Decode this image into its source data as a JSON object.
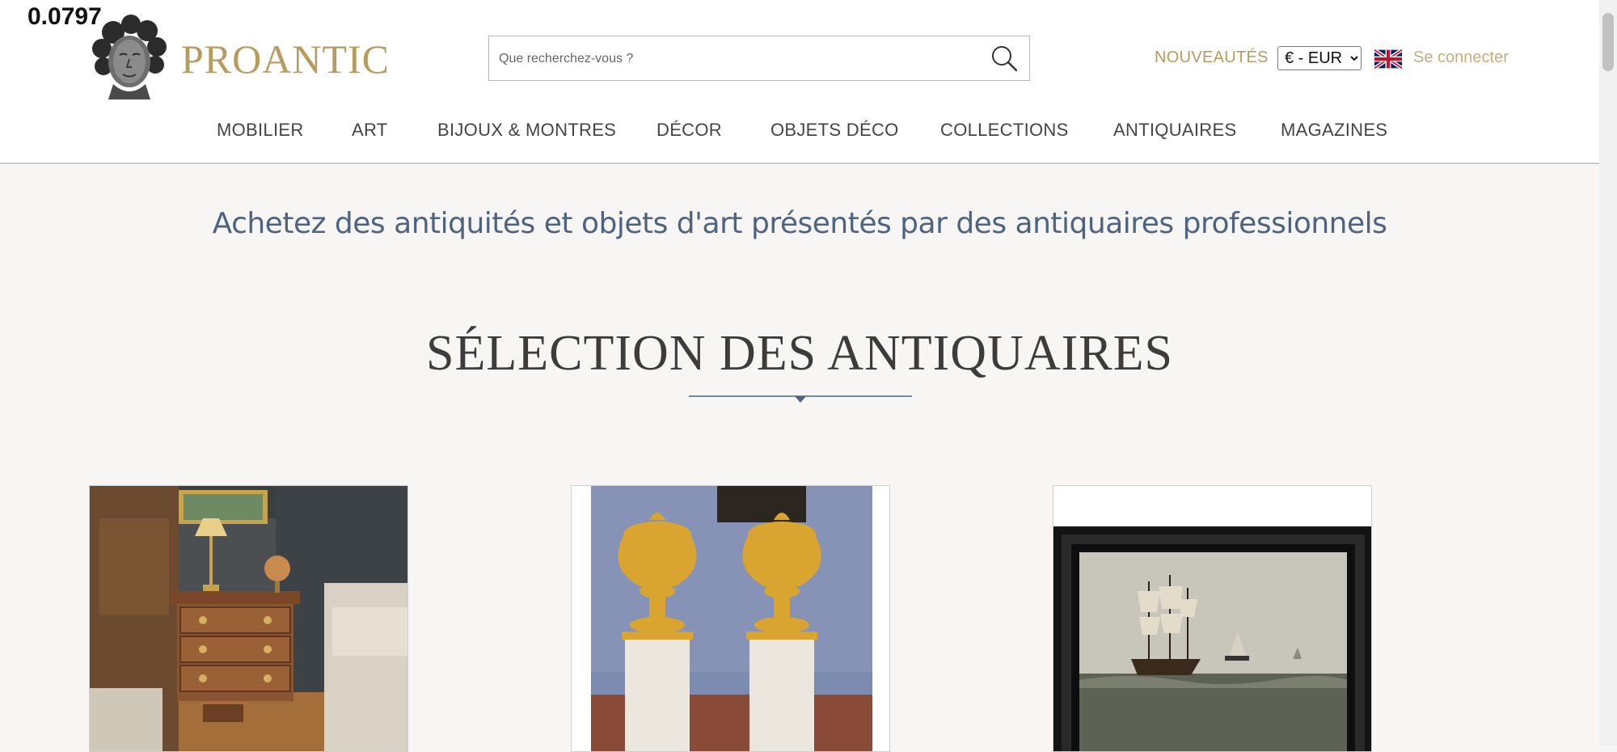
{
  "overlay": {
    "score": "0.0797"
  },
  "header": {
    "logo_text": "PROANTIC",
    "search": {
      "placeholder": "Que recherchez-vous ?"
    },
    "nouveautes": "NOUVEAUTÉS",
    "currency": {
      "selected": "€ - EUR",
      "options": [
        "€ - EUR"
      ]
    },
    "language_flag": "uk-flag-icon",
    "connect": "Se connecter"
  },
  "nav": {
    "items": [
      {
        "label": "MOBILIER"
      },
      {
        "label": "ART"
      },
      {
        "label": "BIJOUX & MONTRES"
      },
      {
        "label": "DÉCOR"
      },
      {
        "label": "OBJETS DÉCO"
      },
      {
        "label": "COLLECTIONS"
      },
      {
        "label": "ANTIQUAIRES"
      },
      {
        "label": "MAGAZINES"
      }
    ]
  },
  "main": {
    "tagline": "Achetez des antiquités et objets d'art présentés par des antiquaires professionnels",
    "section_title": "SÉLECTION DES ANTIQUAIRES",
    "cards": [
      {
        "image": "furniture-side-table-image"
      },
      {
        "image": "gilded-bronze-vases-image"
      },
      {
        "image": "marine-ship-painting-image"
      }
    ]
  },
  "colors": {
    "gold": "#b89b5e",
    "gold_light": "#c7ae7c",
    "tagline_blue": "#4d6380",
    "nav_text": "#444444",
    "page_bg": "#f7f6f4"
  }
}
